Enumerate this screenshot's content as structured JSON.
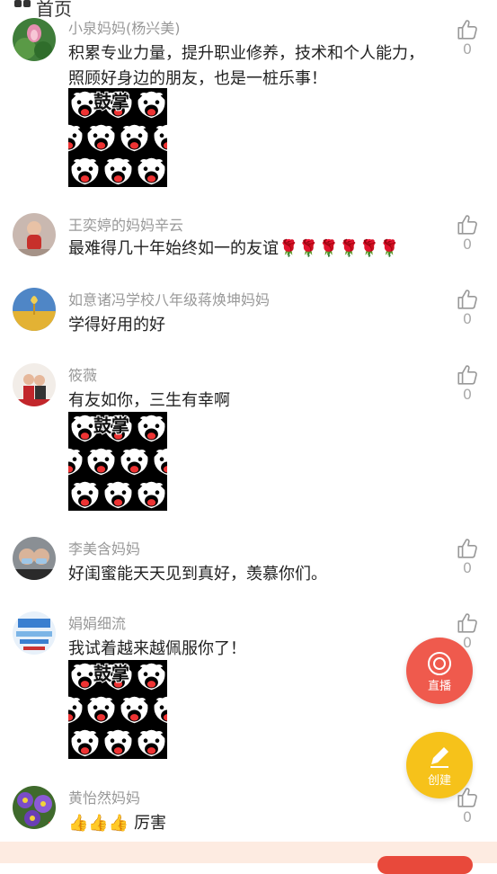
{
  "header": {
    "title": "首页"
  },
  "comments": [
    {
      "name": "小泉妈妈(杨兴美)",
      "text": "积累专业力量，提升职业修养，技术和个人能力，照顾好身边的朋友，也是一桩乐事！",
      "likes": "0",
      "has_sticker": true,
      "avatar_icon": "lotus-avatar"
    },
    {
      "name": "王奕婷的妈妈辛云",
      "text": "最难得几十年始终如一的友谊🌹🌹🌹🌹🌹🌹",
      "likes": "0",
      "has_sticker": false,
      "avatar_icon": "child-avatar"
    },
    {
      "name": "如意诸冯学校八年级蒋焕坤妈妈",
      "text": "学得好用的好",
      "likes": "0",
      "has_sticker": false,
      "avatar_icon": "wheat-field-avatar"
    },
    {
      "name": "筱薇",
      "text": "有友如你，三生有幸啊",
      "likes": "0",
      "has_sticker": true,
      "avatar_icon": "couple-avatar"
    },
    {
      "name": "李美含妈妈",
      "text": "好闺蜜能天天见到真好，羡慕你们。",
      "likes": "0",
      "has_sticker": false,
      "avatar_icon": "masked-people-avatar"
    },
    {
      "name": "娟娟细流",
      "text": "我试着越来越佩服你了！",
      "likes": "0",
      "has_sticker": true,
      "avatar_icon": "poster-avatar"
    },
    {
      "name": "黄怡然妈妈",
      "text": "👍👍👍 厉害",
      "likes": "0",
      "has_sticker": false,
      "avatar_icon": "purple-flowers-avatar"
    }
  ],
  "sticker": {
    "label": "鼓掌",
    "icon": "clapping-dogs-sticker"
  },
  "fab": {
    "live_label": "直播",
    "live_color": "#ef5a4d",
    "create_label": "创建",
    "create_color": "#f6c21a"
  },
  "colors": {
    "name": "#999999",
    "text": "#222222",
    "like": "#aaaaaa",
    "bottom_bar": "#fdebe1",
    "bottom_button": "#e8493b"
  }
}
